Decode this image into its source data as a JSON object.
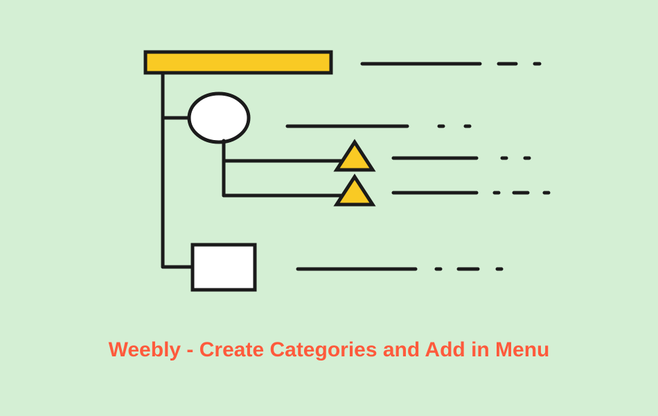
{
  "caption": "Weebly - Create Categories and Add in Menu",
  "colors": {
    "background": "#d4efd4",
    "accent_yellow": "#f9ca24",
    "stroke": "#1b1b1b",
    "shape_fill": "#ffffff",
    "caption_color": "#ff5a3c"
  },
  "diagram": {
    "shapes": [
      {
        "type": "rectangle",
        "role": "root-bar",
        "fill": "yellow"
      },
      {
        "type": "ellipse",
        "role": "child-1",
        "fill": "white"
      },
      {
        "type": "triangle",
        "role": "grandchild-1",
        "fill": "yellow"
      },
      {
        "type": "triangle",
        "role": "grandchild-2",
        "fill": "yellow"
      },
      {
        "type": "rectangle",
        "role": "child-2",
        "fill": "white"
      }
    ]
  }
}
